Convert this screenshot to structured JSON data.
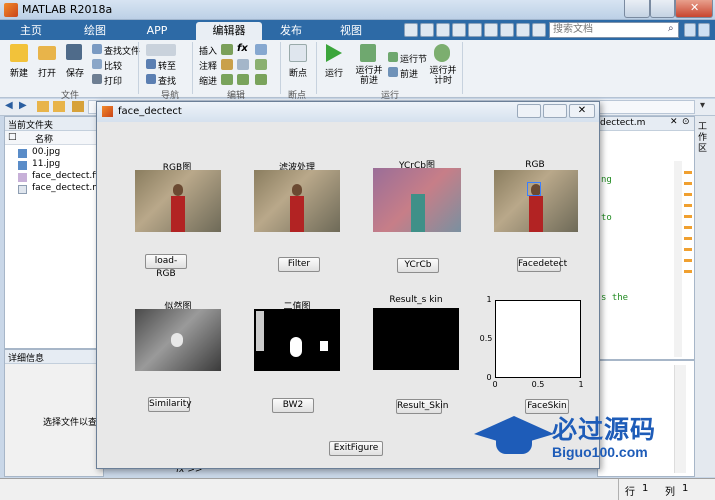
{
  "app": {
    "title": "MATLAB R2018a"
  },
  "tabs": [
    "主页",
    "绘图",
    "APP",
    "编辑器",
    "发布",
    "视图"
  ],
  "search": {
    "placeholder": "搜索文档"
  },
  "ribbon": {
    "file": {
      "new": "新建",
      "open": "打开",
      "save": "保存",
      "find_files": "查找文件",
      "compare": "比较",
      "print": "打印",
      "group": "文件"
    },
    "nav": {
      "goto": "转至",
      "find": "查找",
      "group": "导航"
    },
    "edit": {
      "insert": "插入",
      "comment": "注释",
      "indent": "缩进",
      "fx": "fx",
      "group": "编辑"
    },
    "breakpoint": {
      "label": "断点",
      "group": "断点"
    },
    "run": {
      "run": "运行",
      "run_advance": "运行并\n前进",
      "run_section": "运行节",
      "advance": "前进",
      "run_time": "运行并\n计时",
      "group": "运行"
    }
  },
  "filepanel": {
    "title": "当前文件夹",
    "col_name": "名称",
    "files": [
      "00.jpg",
      "11.jpg",
      "face_dectect.fig",
      "face_dectect.m"
    ]
  },
  "detailpanel": {
    "title": "详细信息",
    "hint": "选择文件以查看"
  },
  "editor": {
    "tab": "dectect.m",
    "code": [
      "ng",
      "to",
      "s the"
    ]
  },
  "cmd": {
    "prompt": "fx >>"
  },
  "status": {
    "row_label": "行",
    "row": "1",
    "col_label": "列",
    "col": "1"
  },
  "figure": {
    "title": "face_dectect",
    "labels": {
      "rgb1": "RGB图",
      "filter": "滤波处理",
      "ycrcb": "YCrCb图",
      "rgb2": "RGB",
      "similar": "似然图",
      "binary": "二值图",
      "result_skin": "Result_s kin"
    },
    "buttons": {
      "load": "load-RGB",
      "filter": "Filter",
      "ycrcb": "YCrCb",
      "facedetect": "Facedetect",
      "similarity": "Similarity",
      "bw2": "BW2",
      "result_skin": "Result_Skin",
      "faceskin": "FaceSkin",
      "exit": "ExitFigure"
    },
    "axis": {
      "y_ticks": [
        "1",
        "0.5",
        "0"
      ],
      "x_ticks": [
        "0",
        "0.5",
        "1"
      ]
    }
  },
  "watermark": {
    "cn": "必过源码",
    "en": "Biguo100.com"
  }
}
